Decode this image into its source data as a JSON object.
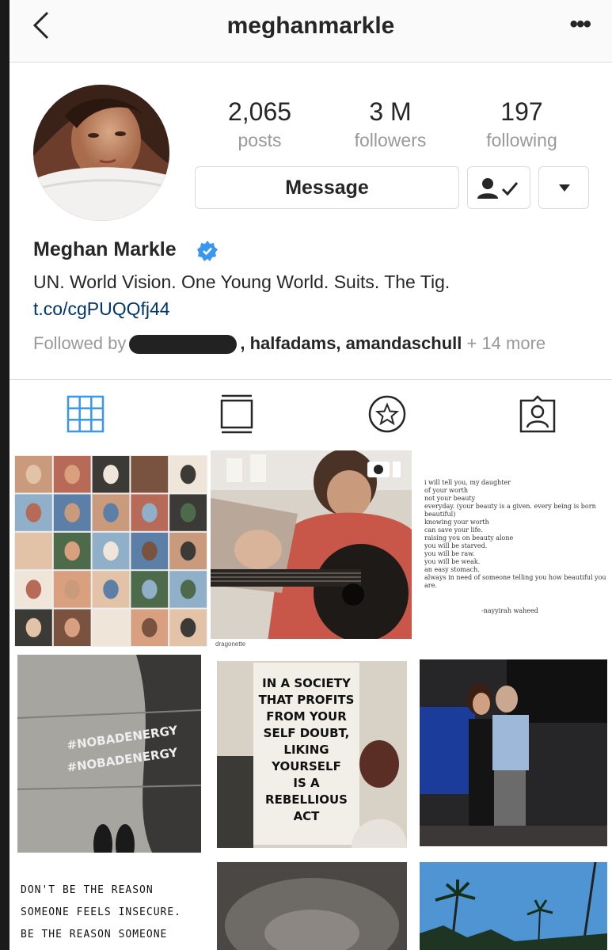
{
  "header": {
    "username": "meghanmarkle",
    "back_icon": "chevron-left-icon",
    "more_icon": "ellipsis-icon",
    "more_label": "•••"
  },
  "profile": {
    "stats": [
      {
        "value": "2,065",
        "label": "posts"
      },
      {
        "value": "3 M",
        "label": "followers"
      },
      {
        "value": "197",
        "label": "following"
      }
    ],
    "message_button": "Message",
    "display_name": "Meghan Markle",
    "bio": "UN. World Vision. One Young World. Suits. The Tig.",
    "link": "t.co/cgPUQQfj44",
    "followed_by_prefix": "Followed by",
    "followed_by_names": ", halfadams, amandaschull",
    "followed_by_more": " + 14 more"
  },
  "tabs": [
    "grid-icon",
    "feed-icon",
    "saved-star-icon",
    "tagged-person-icon"
  ],
  "posts": {
    "video_credit": "dragonette",
    "poem": "i will tell you, my daughter\nof your worth\nnot your beauty\neveryday. (your beauty is a given. every being is born\nbeautiful)\nknowing your worth\ncan save your life.\nraising you on beauty alone\nyou will be starved.\nyou will be raw.\nyou will be weak.\nan easy stomach.\nalways in need of someone telling you how beautiful you\nare.",
    "poem_author": "-nayyirah waheed",
    "hashtag": "#NOBADENERGY",
    "sign_text": "IN A SOCIETY\nTHAT PROFITS\nFROM YOUR\nSELF DOUBT,\nLIKING YOURSELF\nIS A\nREBELLIOUS\nACT",
    "handwritten": "DON'T BE THE REASON\nSOMEONE FEELS INSECURE.\nBE THE REASON SOMEONE"
  },
  "colors": {
    "accent_blue": "#3897f0",
    "link": "#003569",
    "muted": "#999999"
  }
}
